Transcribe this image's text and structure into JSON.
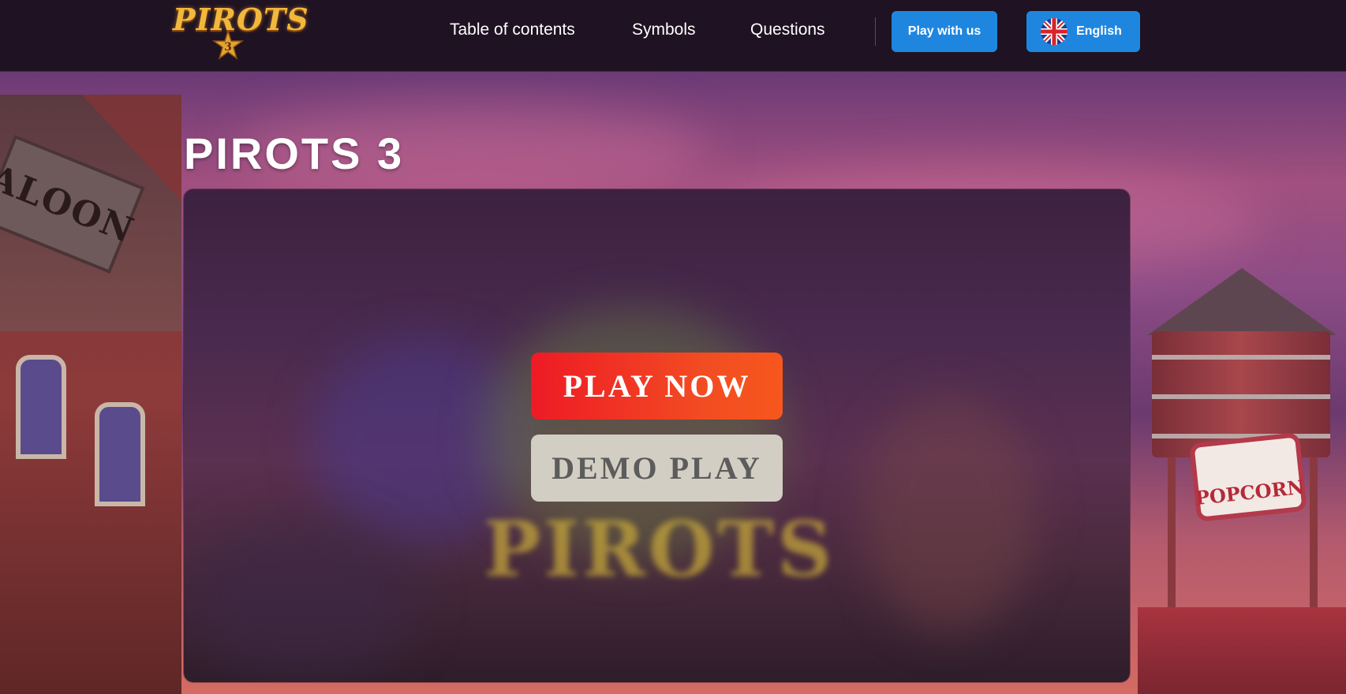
{
  "header": {
    "logo_text": "PIROTS",
    "logo_number": "3",
    "nav": [
      {
        "label": "Table of contents"
      },
      {
        "label": "Symbols"
      },
      {
        "label": "Questions"
      }
    ],
    "play_with_us_label": "Play with us",
    "language_label": "English"
  },
  "background": {
    "saloon_sign": "ALOON",
    "popcorn_sign": "POPCORN"
  },
  "main": {
    "title": "PIROTS 3",
    "play_now_label": "PLAY NOW",
    "demo_play_label": "DEMO PLAY"
  },
  "colors": {
    "header_bg": "#1f1222",
    "accent_blue": "#1f86e0",
    "play_now_gradient_start": "#ee1a25",
    "play_now_gradient_end": "#f7571c",
    "demo_play_bg": "#d3cec3"
  },
  "icons": {
    "language": "uk-flag-icon",
    "logo": "sheriff-star-icon"
  }
}
